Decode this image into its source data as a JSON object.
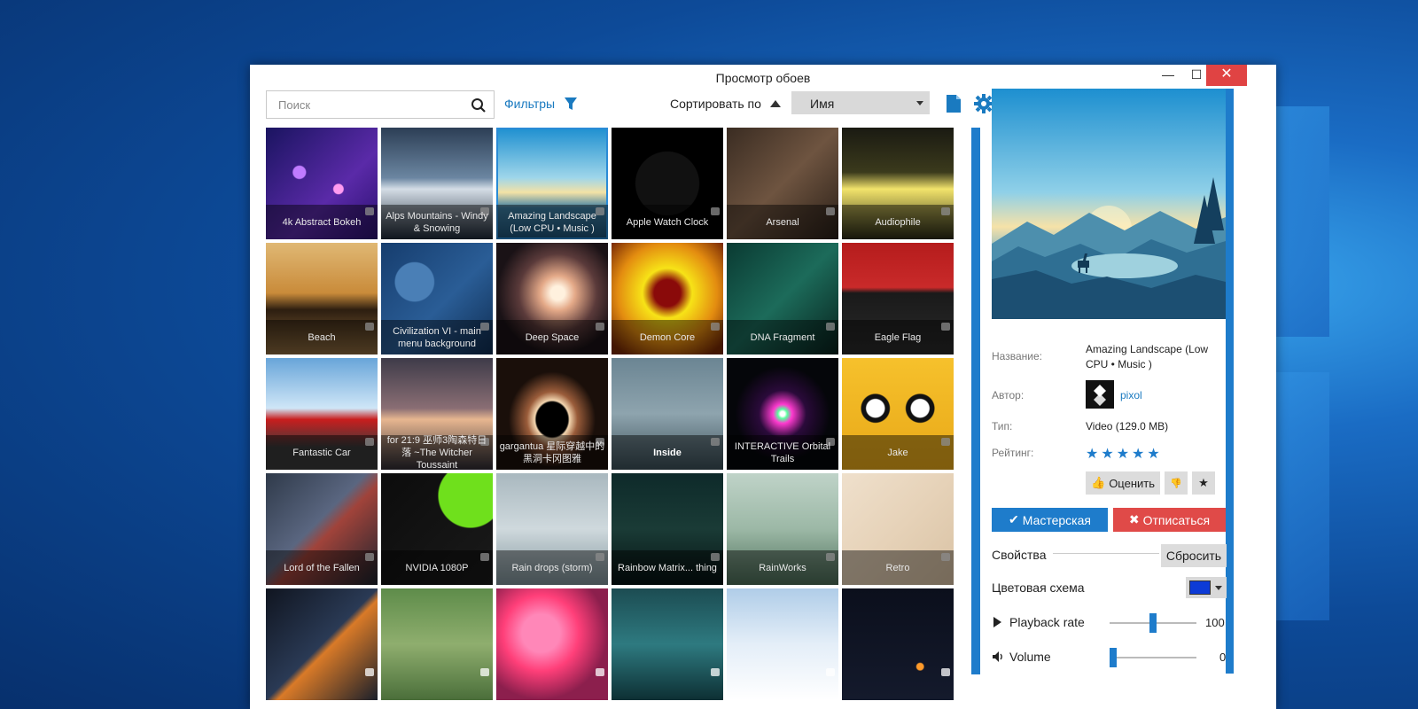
{
  "window": {
    "title": "Просмотр обоев",
    "min_glyph": "—",
    "max_glyph": "☐",
    "close_glyph": "✕"
  },
  "toolbar": {
    "search_placeholder": "Поиск",
    "filters_label": "Фильтры",
    "sort_label": "Сортировать по",
    "sort_value": "Имя"
  },
  "wallpapers": [
    {
      "title": "4k Abstract Bokeh"
    },
    {
      "title": "Alps Mountains - Windy & Snowing"
    },
    {
      "title": "Amazing Landscape (Low CPU • Music )"
    },
    {
      "title": "Apple Watch Clock"
    },
    {
      "title": "Arsenal"
    },
    {
      "title": "Audiophile"
    },
    {
      "title": "Beach"
    },
    {
      "title": "Civilization VI - main menu background"
    },
    {
      "title": "Deep Space"
    },
    {
      "title": "Demon Core"
    },
    {
      "title": "DNA Fragment"
    },
    {
      "title": "Eagle Flag"
    },
    {
      "title": "Fantastic Car"
    },
    {
      "title": "for 21:9 巫师3陶森特日落 ~The Witcher Toussaint"
    },
    {
      "title": "gargantua 星际穿越中的黑洞卡冈图雅"
    },
    {
      "title": "Inside"
    },
    {
      "title": "INTERACTIVE Orbital Trails"
    },
    {
      "title": "Jake"
    },
    {
      "title": "Lord of the Fallen"
    },
    {
      "title": "NVIDIA 1080P"
    },
    {
      "title": "Rain drops (storm)"
    },
    {
      "title": "Rainbow Matrix... thing"
    },
    {
      "title": "RainWorks"
    },
    {
      "title": "Retro"
    },
    {
      "title": ""
    },
    {
      "title": ""
    },
    {
      "title": ""
    },
    {
      "title": ""
    },
    {
      "title": ""
    },
    {
      "title": ""
    }
  ],
  "details": {
    "name_label": "Название:",
    "name_value": "Amazing Landscape (Low CPU • Music )",
    "author_label": "Автор:",
    "author_value": "pixol",
    "type_label": "Тип:",
    "type_value": "Video (129.0 MB)",
    "rating_label": "Рейтинг:",
    "rating_stars": "★★★★★",
    "rate_button": "Оценить",
    "workshop_button": "Мастерская",
    "unsubscribe_button": "Отписаться",
    "properties_label": "Свойства",
    "reset_button": "Сбросить",
    "color_scheme_label": "Цветовая схема",
    "color_scheme_value": "#0d3bd6",
    "playback_label": "Playback rate",
    "playback_value": "100",
    "volume_label": "Volume",
    "volume_value": "0"
  }
}
